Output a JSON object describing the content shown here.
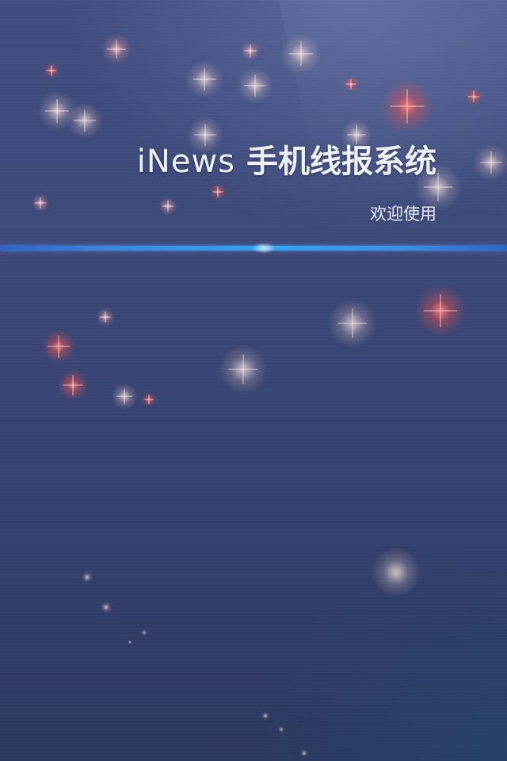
{
  "splash": {
    "brand": "iNews",
    "title_cn": "手机线报系统",
    "subtitle": "欢迎使用"
  },
  "colors": {
    "background_top": "#414d7f",
    "background_bottom": "#2d385f",
    "divider": "#35a5ee",
    "title_text": "#eef2f7"
  }
}
